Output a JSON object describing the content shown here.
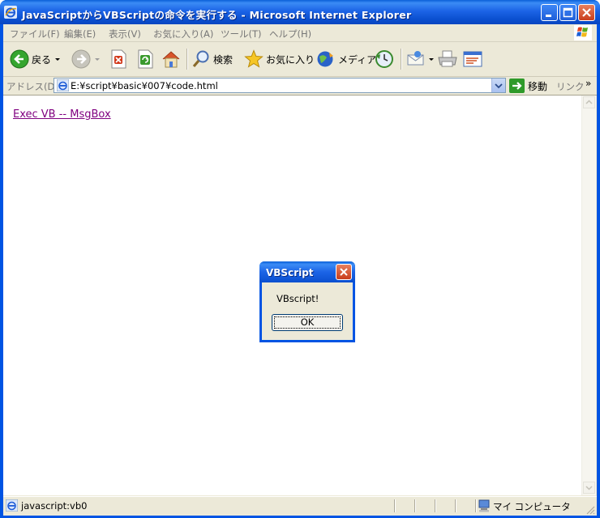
{
  "window": {
    "title": "JavaScriptからVBScriptの命令を実行する - Microsoft Internet Explorer"
  },
  "menu": {
    "items": [
      "ファイル(F)",
      "編集(E)",
      "表示(V)",
      "お気に入り(A)",
      "ツール(T)",
      "ヘルプ(H)"
    ]
  },
  "toolbar": {
    "back_label": "戻る",
    "search_label": "検索",
    "favorites_label": "お気に入り",
    "media_label": "メディア"
  },
  "address": {
    "label": "アドレス(D)",
    "url": "E:¥script¥basic¥007¥code.html",
    "go_label": "移動",
    "links_label": "リンク"
  },
  "content": {
    "link_text": "Exec VB -- MsgBox"
  },
  "status": {
    "text": "javascript:vb0",
    "zone": "マイ コンピュータ"
  },
  "dialog": {
    "title": "VBScript",
    "message": "VBscript!",
    "ok_label": "OK"
  }
}
